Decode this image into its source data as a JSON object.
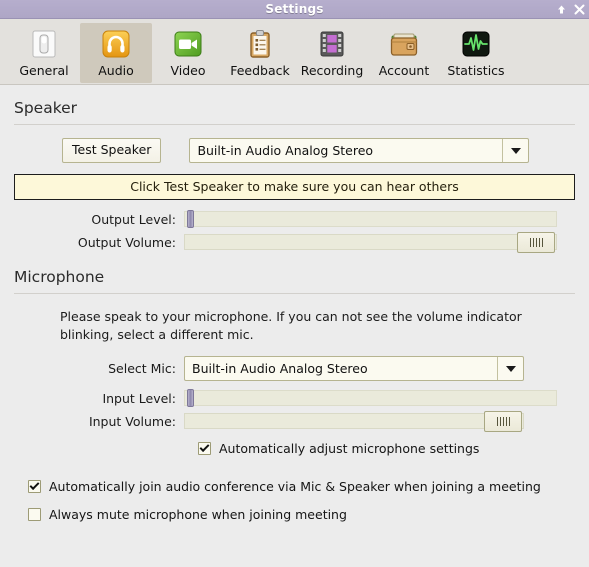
{
  "window": {
    "title": "Settings",
    "controls": [
      {
        "name": "shade-button",
        "icon": "up-arrow-icon"
      },
      {
        "name": "close-button",
        "icon": "close-icon"
      }
    ]
  },
  "toolbar": {
    "items": [
      {
        "label": "General",
        "icon": "switch-icon",
        "selected": false
      },
      {
        "label": "Audio",
        "icon": "headphones-icon",
        "selected": true
      },
      {
        "label": "Video",
        "icon": "camcorder-icon",
        "selected": false
      },
      {
        "label": "Feedback",
        "icon": "clipboard-icon",
        "selected": false
      },
      {
        "label": "Recording",
        "icon": "filmstrip-icon",
        "selected": false
      },
      {
        "label": "Account",
        "icon": "wallet-icon",
        "selected": false
      },
      {
        "label": "Statistics",
        "icon": "waveform-icon",
        "selected": false
      }
    ]
  },
  "speaker": {
    "heading": "Speaker",
    "test_button": "Test Speaker",
    "device_value": "Built-in Audio Analog Stereo",
    "banner": "Click Test Speaker to make sure you can hear others",
    "output_level_label": "Output Level:",
    "output_level_value": 0,
    "output_volume_label": "Output Volume:",
    "output_volume_value": 100
  },
  "microphone": {
    "heading": "Microphone",
    "help": "Please speak to your microphone. If you can not see the volume indicator blinking, select a different mic.",
    "select_mic_label": "Select Mic:",
    "device_value": "Built-in Audio Analog Stereo",
    "input_level_label": "Input Level:",
    "input_level_value": 0,
    "input_volume_label": "Input Volume:",
    "input_volume_value": 100,
    "auto_adjust": {
      "label": "Automatically adjust microphone settings",
      "checked": true
    }
  },
  "footer": {
    "options": [
      {
        "label": "Automatically join audio conference via Mic & Speaker when joining a meeting",
        "checked": true
      },
      {
        "label": "Always mute microphone when joining meeting",
        "checked": false
      }
    ]
  },
  "colors": {
    "titlebar": "#b0a8c8",
    "toolbar": "#e3e1dd",
    "selected_tab": "#cfc9bc",
    "body": "#ececec",
    "field": "#fbfaf0",
    "field_border": "#b6b490",
    "banner_bg": "#fdf8d9",
    "slider_track": "#eaeadb",
    "level_handle": "#8d87ab"
  }
}
